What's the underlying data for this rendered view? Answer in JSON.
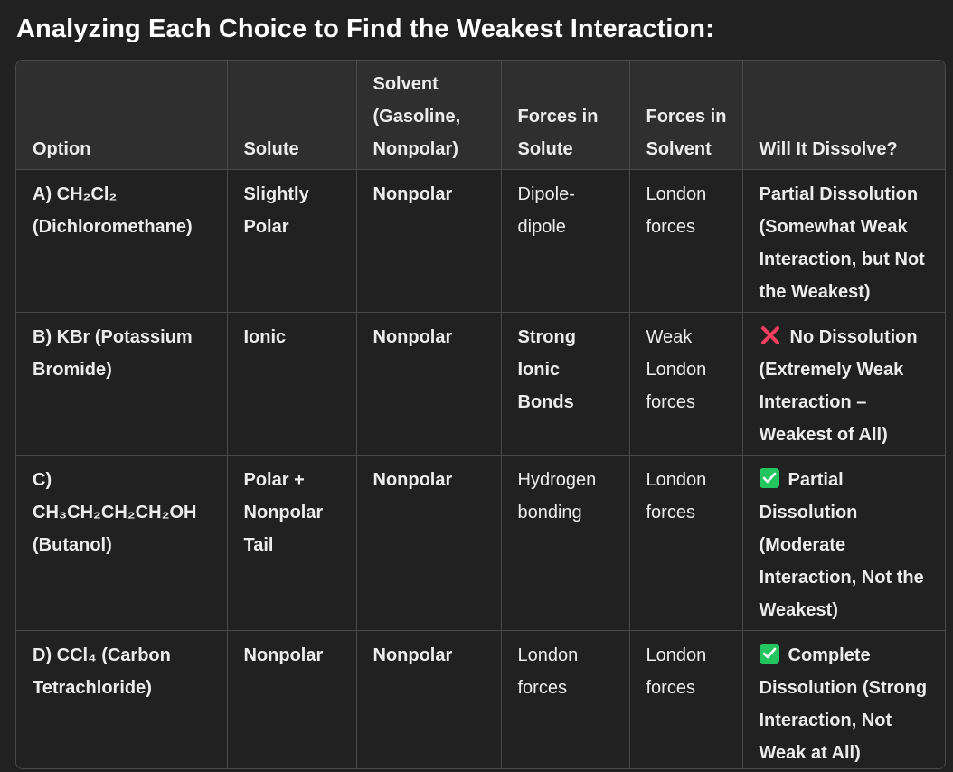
{
  "heading": "Analyzing Each Choice to Find the Weakest Interaction:",
  "table": {
    "headers": [
      "Option",
      "Solute",
      "Solvent (Gasoline, Nonpolar)",
      "Forces in Solute",
      "Forces in Solvent",
      "Will It Dissolve?"
    ],
    "rows": [
      {
        "option": "A) CH₂Cl₂ (Dichloromethane)",
        "solute": "Slightly Polar",
        "solvent": "Nonpolar",
        "forces_solute": "Dipole-dipole",
        "forces_solvent": "London forces",
        "dissolve": "Partial Dissolution (Somewhat Weak Interaction, but Not the Weakest)",
        "icon": ""
      },
      {
        "option": "B) KBr (Potassium Bromide)",
        "solute": "Ionic",
        "solvent": "Nonpolar",
        "forces_solute": "Strong Ionic Bonds",
        "forces_solvent": "Weak London forces",
        "dissolve": "No Dissolution (Extremely Weak Interaction – Weakest of All)",
        "icon": "cross-mark-icon"
      },
      {
        "option": "C) CH₃CH₂CH₂CH₂OH (Butanol)",
        "solute": "Polar + Nonpolar Tail",
        "solvent": "Nonpolar",
        "forces_solute": "Hydrogen bonding",
        "forces_solvent": "London forces",
        "dissolve": "Partial Dissolution (Moderate Interaction, Not the Weakest)",
        "icon": "check-mark-icon"
      },
      {
        "option": "D) CCl₄ (Carbon Tetrachloride)",
        "solute": "Nonpolar",
        "solvent": "Nonpolar",
        "forces_solute": "London forces",
        "forces_solvent": "London forces",
        "dissolve": "Complete Dissolution (Strong Interaction, Not Weak at All)",
        "icon": "check-mark-icon"
      }
    ]
  },
  "colors": {
    "background": "#212121",
    "header_background": "#2f2f2f",
    "border": "#4a4a4a",
    "text": "#ececec",
    "cross_icon": "#f43f5e",
    "check_icon": "#22c55e"
  }
}
